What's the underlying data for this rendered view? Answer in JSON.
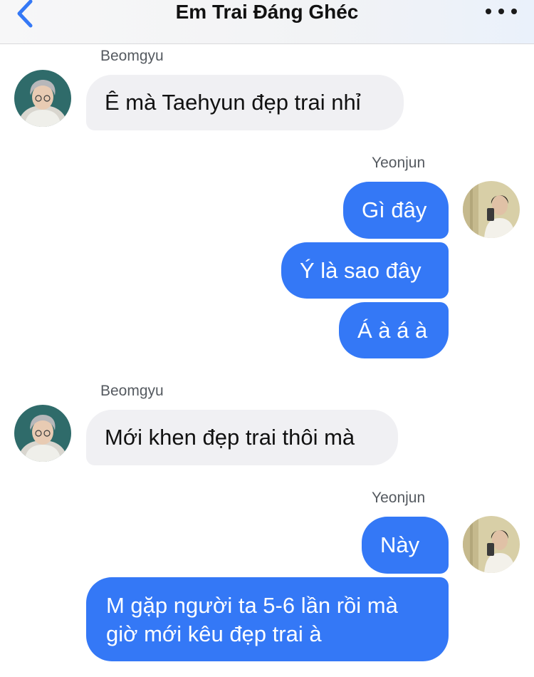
{
  "header": {
    "title": "Em Trai Đáng Ghéc",
    "back_icon": "chevron-left-icon",
    "more_icon": "ellipsis-icon",
    "accent": "#3478f6"
  },
  "colors": {
    "incoming_bubble": "#f0f0f3",
    "outgoing_bubble": "#3478f6"
  },
  "messages": [
    {
      "sender": "Beomgyu",
      "text": "Ê mà Taehyun đẹp trai nhỉ"
    },
    {
      "sender": "Yeonjun",
      "text": "Gì đây"
    },
    {
      "text": "Ý là sao đây"
    },
    {
      "text": "Á à á à"
    },
    {
      "sender": "Beomgyu",
      "text": "Mới khen đẹp trai thôi mà"
    },
    {
      "sender": "Yeonjun",
      "text": "Này"
    },
    {
      "text": "M gặp người ta 5-6 lần rồi mà giờ mới kêu đẹp trai à"
    }
  ]
}
